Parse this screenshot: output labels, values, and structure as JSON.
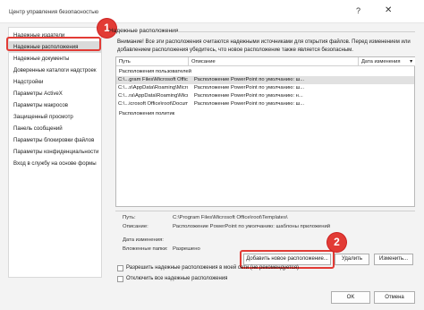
{
  "window": {
    "title": "Центр управления безопасностью",
    "help_glyph": "?",
    "close_glyph": "✕"
  },
  "sidebar": {
    "items": [
      {
        "label": "Надежные издатели"
      },
      {
        "label": "Надежные расположения"
      },
      {
        "label": "Надежные документы"
      },
      {
        "label": "Доверенные каталоги надстроек"
      },
      {
        "label": "Надстройки"
      },
      {
        "label": "Параметры ActiveX"
      },
      {
        "label": "Параметры макросов"
      },
      {
        "label": "Защищенный просмотр"
      },
      {
        "label": "Панель сообщений"
      },
      {
        "label": "Параметры блокировки файлов"
      },
      {
        "label": "Параметры конфиденциальности"
      },
      {
        "label": "Вход в службу на основе формы"
      }
    ]
  },
  "annotations": {
    "badge1": "1",
    "badge2": "2",
    "highlight_color": "#e23b35"
  },
  "main": {
    "section_title": "Надежные расположения",
    "warning": "Внимание! Все эти расположения считаются надежными источниками для открытия файлов. Перед изменением или добавлением расположения убедитесь, что новое расположение также является безопасным.",
    "table": {
      "columns": [
        "Путь",
        "Описание",
        "Дата изменения"
      ],
      "sort_glyph": "▾",
      "user_group": "Расположения пользователей",
      "policy_group": "Расположения политик",
      "rows": [
        {
          "path": "C:\\...gram Files\\Microsoft Office\\root\\Templates\\",
          "description": "Расположение PowerPoint по умолчанию: ш..."
        },
        {
          "path": "C:\\...s\\AppData\\Roaming\\Microsoft\\Templates\\",
          "description": "Расположение PowerPoint по умолчанию: ш..."
        },
        {
          "path": "C:\\...ra\\AppData\\Roaming\\Microsoft\\Addins\\",
          "description": "Расположение PowerPoint по умолчанию: н..."
        },
        {
          "path": "C:\\...icrosoft Office\\root\\Document Themes 16\\",
          "description": "Расположение PowerPoint по умолчанию: ш..."
        }
      ]
    },
    "details": {
      "path_label": "Путь:",
      "path_value": "C:\\Program Files\\Microsoft Office\\root\\Templates\\",
      "desc_label": "Описание:",
      "desc_value": "Расположение PowerPoint по умолчанию: шаблоны приложений",
      "date_label": "Дата изменения:",
      "subfolders_label": "Вложенные папки:",
      "subfolders_value": "Разрешено"
    },
    "buttons": {
      "add": "Добавить новое расположение...",
      "remove": "Удалить",
      "modify": "Изменить..."
    },
    "checkboxes": [
      {
        "label": "Разрешить надежные расположения в моей сети (не рекомендуется)",
        "checked": false
      },
      {
        "label": "Отключить все надежные расположения",
        "checked": false
      }
    ]
  },
  "footer": {
    "ok": "OK",
    "cancel": "Отмена"
  }
}
